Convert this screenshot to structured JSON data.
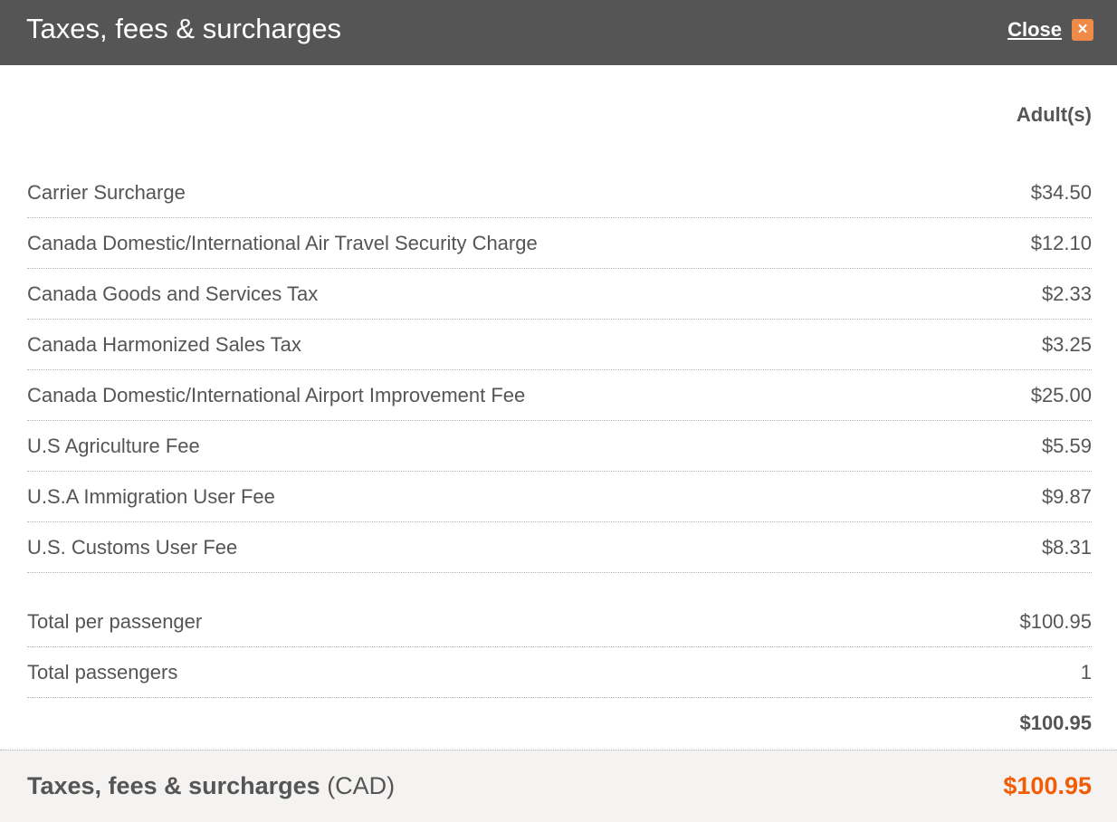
{
  "dialog": {
    "title": "Taxes, fees & surcharges",
    "close_label": "Close",
    "close_icon": "close-icon"
  },
  "table": {
    "column_header": "Adult(s)",
    "items": [
      {
        "label": "Carrier Surcharge",
        "amount": "$34.50"
      },
      {
        "label": "Canada Domestic/International Air Travel Security Charge",
        "amount": "$12.10"
      },
      {
        "label": "Canada Goods and Services Tax",
        "amount": "$2.33"
      },
      {
        "label": "Canada Harmonized Sales Tax",
        "amount": "$3.25"
      },
      {
        "label": "Canada Domestic/International Airport Improvement Fee",
        "amount": "$25.00"
      },
      {
        "label": "U.S Agriculture Fee",
        "amount": "$5.59"
      },
      {
        "label": "U.S.A Immigration User Fee",
        "amount": "$9.87"
      },
      {
        "label": "U.S. Customs User Fee",
        "amount": "$8.31"
      }
    ],
    "total_per_passenger": {
      "label": "Total per passenger",
      "amount": "$100.95"
    },
    "total_passengers": {
      "label": "Total passengers",
      "amount": "1"
    },
    "subtotal": "$100.95"
  },
  "footer": {
    "label": "Taxes, fees & surcharges",
    "currency": "(CAD)",
    "total": "$100.95"
  },
  "colors": {
    "header_bg": "#555555",
    "accent_orange": "#f25c05",
    "footer_bg": "#f4f3f1",
    "close_icon_bg": "#f08a48"
  }
}
